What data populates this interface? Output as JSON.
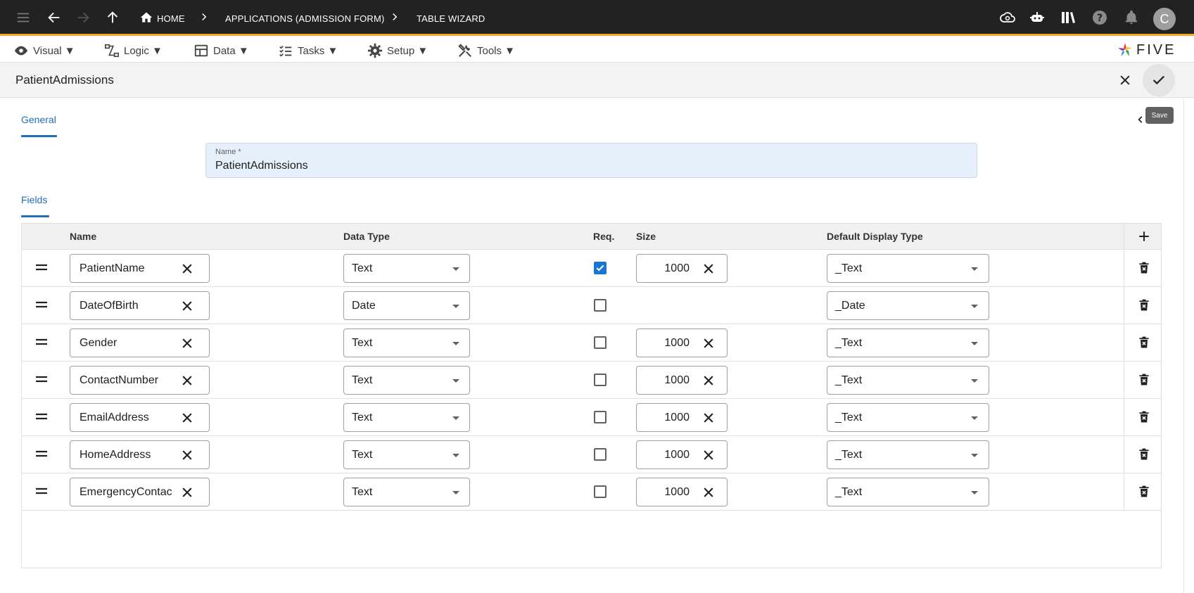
{
  "topbar": {
    "breadcrumbs": [
      {
        "label": "HOME"
      },
      {
        "label": "APPLICATIONS (ADMISSION FORM)"
      },
      {
        "label": "TABLE WIZARD"
      }
    ],
    "avatar_initial": "C",
    "bg_color": "#222222",
    "accent_color": "#f5a623"
  },
  "menu": {
    "items": [
      {
        "label": "Visual ▼",
        "icon": "eye-icon"
      },
      {
        "label": "Logic ▼",
        "icon": "flow-icon"
      },
      {
        "label": "Data ▼",
        "icon": "table-icon"
      },
      {
        "label": "Tasks ▼",
        "icon": "checklist-icon"
      },
      {
        "label": "Setup ▼",
        "icon": "gear-icon"
      },
      {
        "label": "Tools ▼",
        "icon": "tools-icon"
      }
    ],
    "logo_text": "FIVE"
  },
  "form": {
    "title": "PatientAdmissions",
    "save_tooltip": "Save"
  },
  "tabs": {
    "general": "General",
    "fields": "Fields"
  },
  "name_field": {
    "label": "Name *",
    "value": "PatientAdmissions"
  },
  "table": {
    "headers": {
      "name": "Name",
      "data_type": "Data Type",
      "req": "Req.",
      "size": "Size",
      "display": "Default Display Type"
    },
    "rows": [
      {
        "name": "PatientName",
        "data_type": "Text",
        "req": true,
        "size": "1000",
        "display": "_Text"
      },
      {
        "name": "DateOfBirth",
        "data_type": "Date",
        "req": false,
        "size": "",
        "display": "_Date"
      },
      {
        "name": "Gender",
        "data_type": "Text",
        "req": false,
        "size": "1000",
        "display": "_Text"
      },
      {
        "name": "ContactNumber",
        "data_type": "Text",
        "req": false,
        "size": "1000",
        "display": "_Text"
      },
      {
        "name": "EmailAddress",
        "data_type": "Text",
        "req": false,
        "size": "1000",
        "display": "_Text"
      },
      {
        "name": "HomeAddress",
        "data_type": "Text",
        "req": false,
        "size": "1000",
        "display": "_Text"
      },
      {
        "name": "EmergencyContac",
        "data_type": "Text",
        "req": false,
        "size": "1000",
        "display": "_Text"
      }
    ]
  }
}
